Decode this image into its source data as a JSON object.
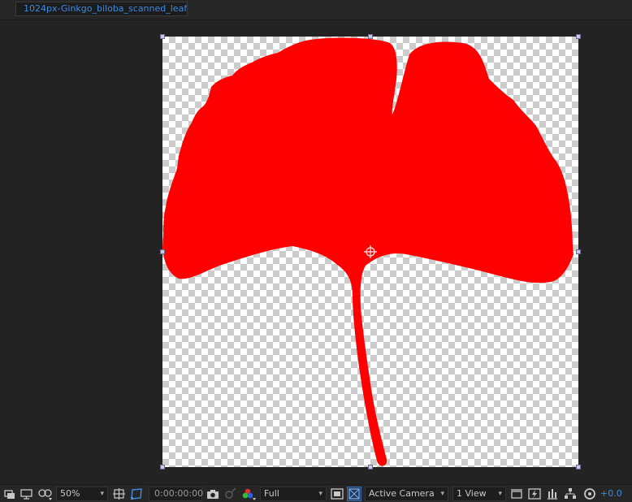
{
  "tab": {
    "title": "1024px-Ginkgo_biloba_scanned_leaf"
  },
  "toolbar": {
    "zoom": "50%",
    "timecode": "0:00:00:00",
    "resolution": "Full",
    "camera": "Active Camera",
    "views": "1 View",
    "exposure": "+0.0"
  },
  "icons": {
    "always_preview": "always-preview-icon",
    "monitor": "monitor-icon",
    "mask": "mask-visibility-icon",
    "safe_zones": "safe-zones-icon",
    "mask_path": "mask-path-icon",
    "camera": "snapshot-icon",
    "show_snapshot": "show-snapshot-icon",
    "channel": "channel-icon",
    "region": "region-of-interest-icon",
    "transparency": "transparency-grid-icon",
    "fast_previews": "fast-previews-icon",
    "timeline": "timeline-icon",
    "flowchart": "flowchart-icon",
    "reset_exposure": "reset-exposure-icon"
  },
  "colors": {
    "leaf": "#ff0000",
    "accent": "#3d8ce0"
  }
}
